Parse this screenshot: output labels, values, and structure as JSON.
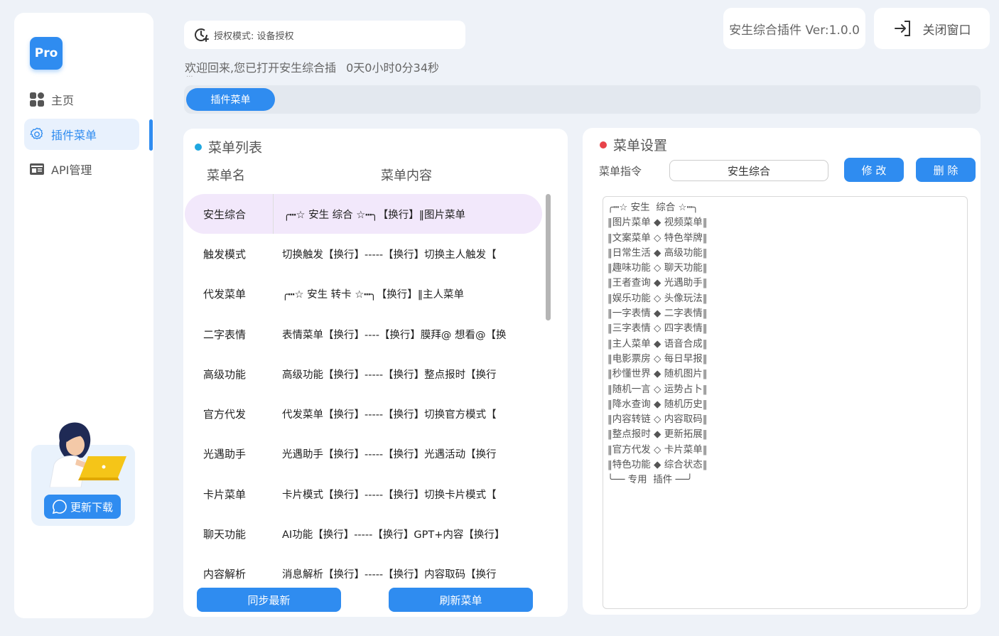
{
  "app": {
    "logo_text": "Pro",
    "version": "安生综合插件 Ver:1.0.0",
    "close_label": "关闭窗口"
  },
  "sidebar": {
    "items": [
      {
        "label": "主页",
        "icon": "grid-icon"
      },
      {
        "label": "插件菜单",
        "icon": "gear-icon"
      },
      {
        "label": "API管理",
        "icon": "api-icon"
      }
    ],
    "update_label": "更新下载"
  },
  "header": {
    "auth_text": "授权模式: 设备授权",
    "welcome_text": "欢迎回来,您已打开安生综合插",
    "welcome_overflow": "...",
    "uptime": "0天0小时0分34秒",
    "tab_label": "插件菜单"
  },
  "menu_list": {
    "title": "菜单列表",
    "col_name": "菜单名",
    "col_content": "菜单内容",
    "rows": [
      {
        "name": "安生综合",
        "content": "╭┅☆ 安生  综合 ☆┅╮【换行】‖图片菜单"
      },
      {
        "name": "触发模式",
        "content": "切换触发【换行】-----【换行】切换主人触发【"
      },
      {
        "name": "代发菜单",
        "content": "╭┅☆ 安生  转卡 ☆┅╮【换行】‖主人菜单"
      },
      {
        "name": "二字表情",
        "content": "表情菜单【换行】----【换行】膜拜@ 想看@【换"
      },
      {
        "name": "高级功能",
        "content": "高级功能【换行】-----【换行】整点报时【换行"
      },
      {
        "name": "官方代发",
        "content": "代发菜单【换行】-----【换行】切换官方模式【"
      },
      {
        "name": "光遇助手",
        "content": "光遇助手【换行】-----【换行】光遇活动【换行"
      },
      {
        "name": "卡片菜单",
        "content": "卡片模式【换行】-----【换行】切换卡片模式【"
      },
      {
        "name": "聊天功能",
        "content": "AI功能【换行】-----【换行】GPT+内容【换行】"
      },
      {
        "name": "内容解析",
        "content": "消息解析【换行】-----【换行】内容取码【换行"
      }
    ],
    "sync_label": "同步最新",
    "refresh_label": "刷新菜单"
  },
  "menu_settings": {
    "title": "菜单设置",
    "cmd_label": "菜单指令",
    "cmd_value": "安生综合",
    "edit_label": "修 改",
    "delete_label": "删 除",
    "content_lines": [
      "╭┅☆ 安生  综合 ☆┅╮",
      "‖图片菜单 ◆ 视频菜单‖",
      "‖文案菜单 ◇ 特色举牌‖",
      "‖日常生活 ◆ 高级功能‖",
      "‖趣味功能 ◇ 聊天功能‖",
      "‖王者查询 ◆ 光遇助手‖",
      "‖娱乐功能 ◇ 头像玩法‖",
      "‖一字表情 ◆ 二字表情‖",
      "‖三字表情 ◇ 四字表情‖",
      "‖主人菜单 ◆ 语音合成‖",
      "‖电影票房 ◇ 每日早报‖",
      "‖秒懂世界 ◆ 随机图片‖",
      "‖随机一言 ◇ 运势占卜‖",
      "‖降水查询 ◆ 随机历史‖",
      "‖内容转链 ◇ 内容取码‖",
      "‖整点报时 ◆ 更新拓展‖",
      "‖官方代发 ◇ 卡片菜单‖",
      "‖特色功能 ◆ 综合状态‖",
      "╰── 专用  插件 ──╯"
    ]
  },
  "colors": {
    "accent": "#2f8cf0",
    "list_dot": "#1fa7e0",
    "settings_dot": "#e8434a",
    "selected_row": "#f2e8fb"
  }
}
